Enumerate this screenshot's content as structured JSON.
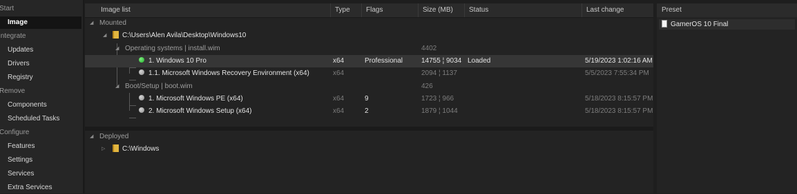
{
  "sidebar": {
    "sections": [
      {
        "category": "Start",
        "items": [
          "Image"
        ]
      },
      {
        "category": "Integrate",
        "items": [
          "Updates",
          "Drivers",
          "Registry"
        ]
      },
      {
        "category": "Remove",
        "items": [
          "Components",
          "Scheduled Tasks"
        ]
      },
      {
        "category": "Configure",
        "items": [
          "Features",
          "Settings",
          "Services",
          "Extra Services"
        ]
      }
    ],
    "active_item": "Image"
  },
  "image_list": {
    "columns": {
      "name": "Image list",
      "type": "Type",
      "flags": "Flags",
      "size": "Size (MB)",
      "status": "Status",
      "last_change": "Last change"
    },
    "mounted_label": "Mounted",
    "mount_path": "C:\\Users\\Alen Avila\\Desktop\\Windows10",
    "groups": [
      {
        "label": "Operating systems  |  install.wim",
        "size": "4402",
        "images": [
          {
            "name": "1. Windows 10 Pro",
            "type": "x64",
            "flags": "Professional",
            "size": "14755 ¦ 9034",
            "status": "Loaded",
            "last_change": "5/19/2023 1:02:16 AM",
            "status_dot": "green",
            "selected": true
          },
          {
            "name": "1.1. Microsoft Windows Recovery Environment (x64)",
            "type": "x64",
            "flags": "",
            "size": "2094 ¦ 1137",
            "status": "",
            "last_change": "5/5/2023 7:55:34 PM",
            "status_dot": "gray",
            "selected": false
          }
        ]
      },
      {
        "label": "Boot/Setup  |  boot.wim",
        "size": "426",
        "images": [
          {
            "name": "1. Microsoft Windows PE (x64)",
            "type": "x64",
            "flags": "9",
            "size": "1723 ¦ 966",
            "status": "",
            "last_change": "5/18/2023 8:15:57 PM",
            "status_dot": "gray",
            "selected": false
          },
          {
            "name": "2. Microsoft Windows Setup (x64)",
            "type": "x64",
            "flags": "2",
            "size": "1879 ¦ 1044",
            "status": "",
            "last_change": "5/18/2023 8:15:57 PM",
            "status_dot": "gray",
            "selected": false
          }
        ]
      }
    ],
    "deployed_label": "Deployed",
    "deployed_path": "C:\\Windows"
  },
  "preset": {
    "header": "Preset",
    "items": [
      "GamerOS 10 Final"
    ]
  },
  "colors": {
    "background": "#1e1e1e",
    "sidebar": "#262626",
    "panel": "#232323",
    "selected_row": "#363636",
    "loaded_dot": "#2ecc40",
    "folder": "#e2b640"
  }
}
